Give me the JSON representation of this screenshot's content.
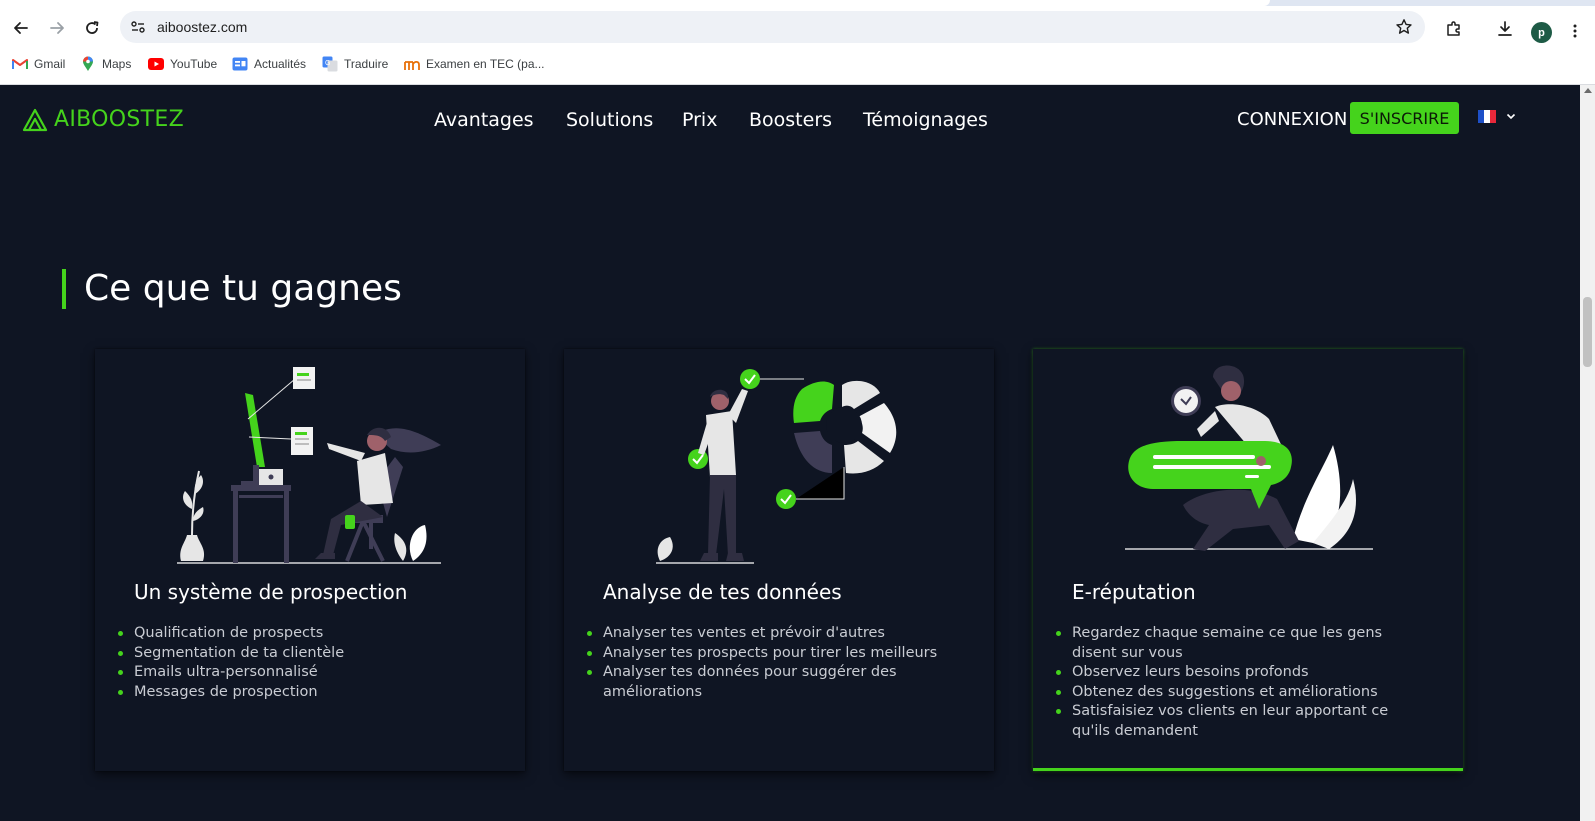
{
  "browser": {
    "url": "aiboostez.com",
    "profile_initial": "p",
    "bookmarks": [
      {
        "label": "Gmail",
        "icon": "gmail-icon"
      },
      {
        "label": "Maps",
        "icon": "maps-icon"
      },
      {
        "label": "YouTube",
        "icon": "youtube-icon"
      },
      {
        "label": "Actualités",
        "icon": "google-news-icon"
      },
      {
        "label": "Traduire",
        "icon": "google-translate-icon"
      },
      {
        "label": "Examen en TEC (pa...",
        "icon": "tec-icon"
      }
    ]
  },
  "site": {
    "brand": "AIBOOSTEZ",
    "accent_color": "#45d31c",
    "background_color": "#0f1523",
    "nav": [
      "Avantages",
      "Solutions",
      "Prix",
      "Boosters",
      "Témoignages"
    ],
    "login": "CONNEXION",
    "signup": "S'INSCRIRE",
    "language_flag": "france-flag-icon"
  },
  "section": {
    "title": "Ce que tu gagnes",
    "cards": [
      {
        "title": "Un système de prospection",
        "illustration": "desk-workstation-illustration",
        "items": [
          "Qualification de prospects",
          "Segmentation de ta clientèle",
          "Emails ultra-personnalisé",
          "Messages de prospection"
        ]
      },
      {
        "title": "Analyse de tes données",
        "illustration": "data-analysis-illustration",
        "items": [
          "Analyser tes ventes et prévoir d'autres",
          "Analyser tes prospects pour tirer les meilleurs",
          "Analyser tes données pour suggérer des améliorations"
        ]
      },
      {
        "title": "E-réputation",
        "illustration": "chat-review-illustration",
        "items": [
          "Regardez chaque semaine ce que les gens disent sur vous",
          "Observez leurs besoins profonds",
          "Obtenez des suggestions et améliorations",
          "Satisfaisiez vos clients en leur apportant ce qu'ils demandent"
        ],
        "highlighted": true
      }
    ]
  }
}
